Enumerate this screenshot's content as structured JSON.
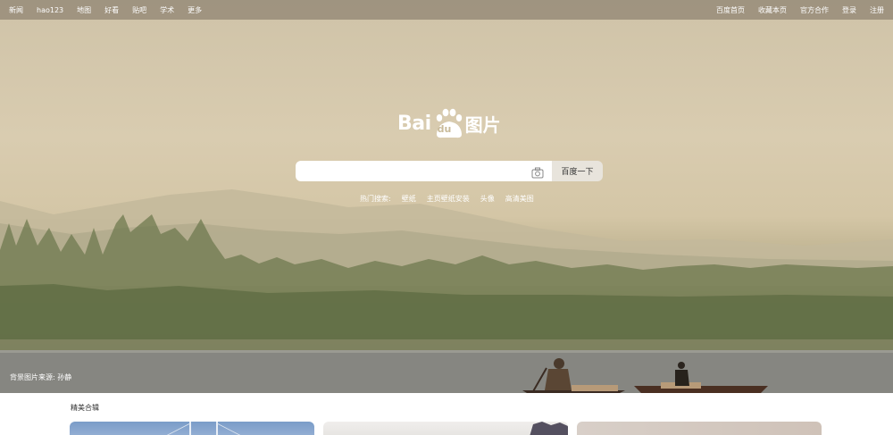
{
  "topnav": {
    "left": [
      "新闻",
      "hao123",
      "地图",
      "好看",
      "贴吧",
      "学术",
      "更多"
    ],
    "right": [
      "百度首页",
      "收藏本页",
      "官方合作",
      "登录",
      "注册"
    ]
  },
  "logo": {
    "bai": "Bai",
    "du": "du",
    "cn": "图片"
  },
  "search": {
    "value": "",
    "placeholder": "",
    "button_label": "百度一下"
  },
  "hot_search": {
    "label": "热门搜索:",
    "items": [
      "壁纸",
      "主页壁纸安装",
      "头像",
      "高清美图"
    ]
  },
  "credit": "背景图片来源: 孙静",
  "section": {
    "title": "精美合辑"
  },
  "colors": {
    "nav_bg": "#786e5f",
    "button_bg": "#e8e4dc"
  }
}
